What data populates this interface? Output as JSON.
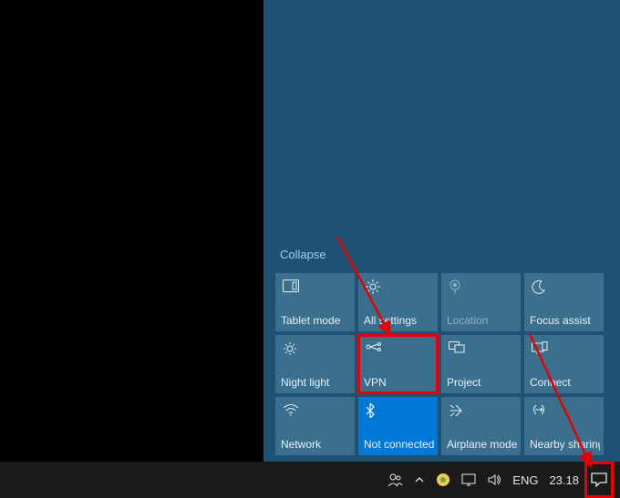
{
  "panel": {
    "collapse_label": "Collapse"
  },
  "tiles": [
    {
      "id": "tablet-mode",
      "label": "Tablet mode",
      "icon": "tablet-mode-icon"
    },
    {
      "id": "all-settings",
      "label": "All settings",
      "icon": "gear-icon"
    },
    {
      "id": "location",
      "label": "Location",
      "icon": "location-icon",
      "disabled": true
    },
    {
      "id": "focus-assist",
      "label": "Focus assist",
      "icon": "moon-icon"
    },
    {
      "id": "night-light",
      "label": "Night light",
      "icon": "sun-icon"
    },
    {
      "id": "vpn",
      "label": "VPN",
      "icon": "vpn-icon",
      "highlight": true
    },
    {
      "id": "project",
      "label": "Project",
      "icon": "project-icon"
    },
    {
      "id": "connect",
      "label": "Connect",
      "icon": "connect-icon"
    },
    {
      "id": "network",
      "label": "Network",
      "icon": "wifi-icon"
    },
    {
      "id": "not-connected",
      "label": "Not connected",
      "icon": "bluetooth-icon",
      "active": true
    },
    {
      "id": "airplane-mode",
      "label": "Airplane mode",
      "icon": "airplane-icon"
    },
    {
      "id": "nearby-sharing",
      "label": "Nearby sharing",
      "icon": "nearby-sharing-icon"
    }
  ],
  "taskbar": {
    "language": "ENG",
    "clock": "23.18"
  },
  "colors": {
    "panel_bg": "#1d5274",
    "tile_bg": "#3a6f8e",
    "tile_active_bg": "#0078d7",
    "highlight": "#e60000"
  }
}
